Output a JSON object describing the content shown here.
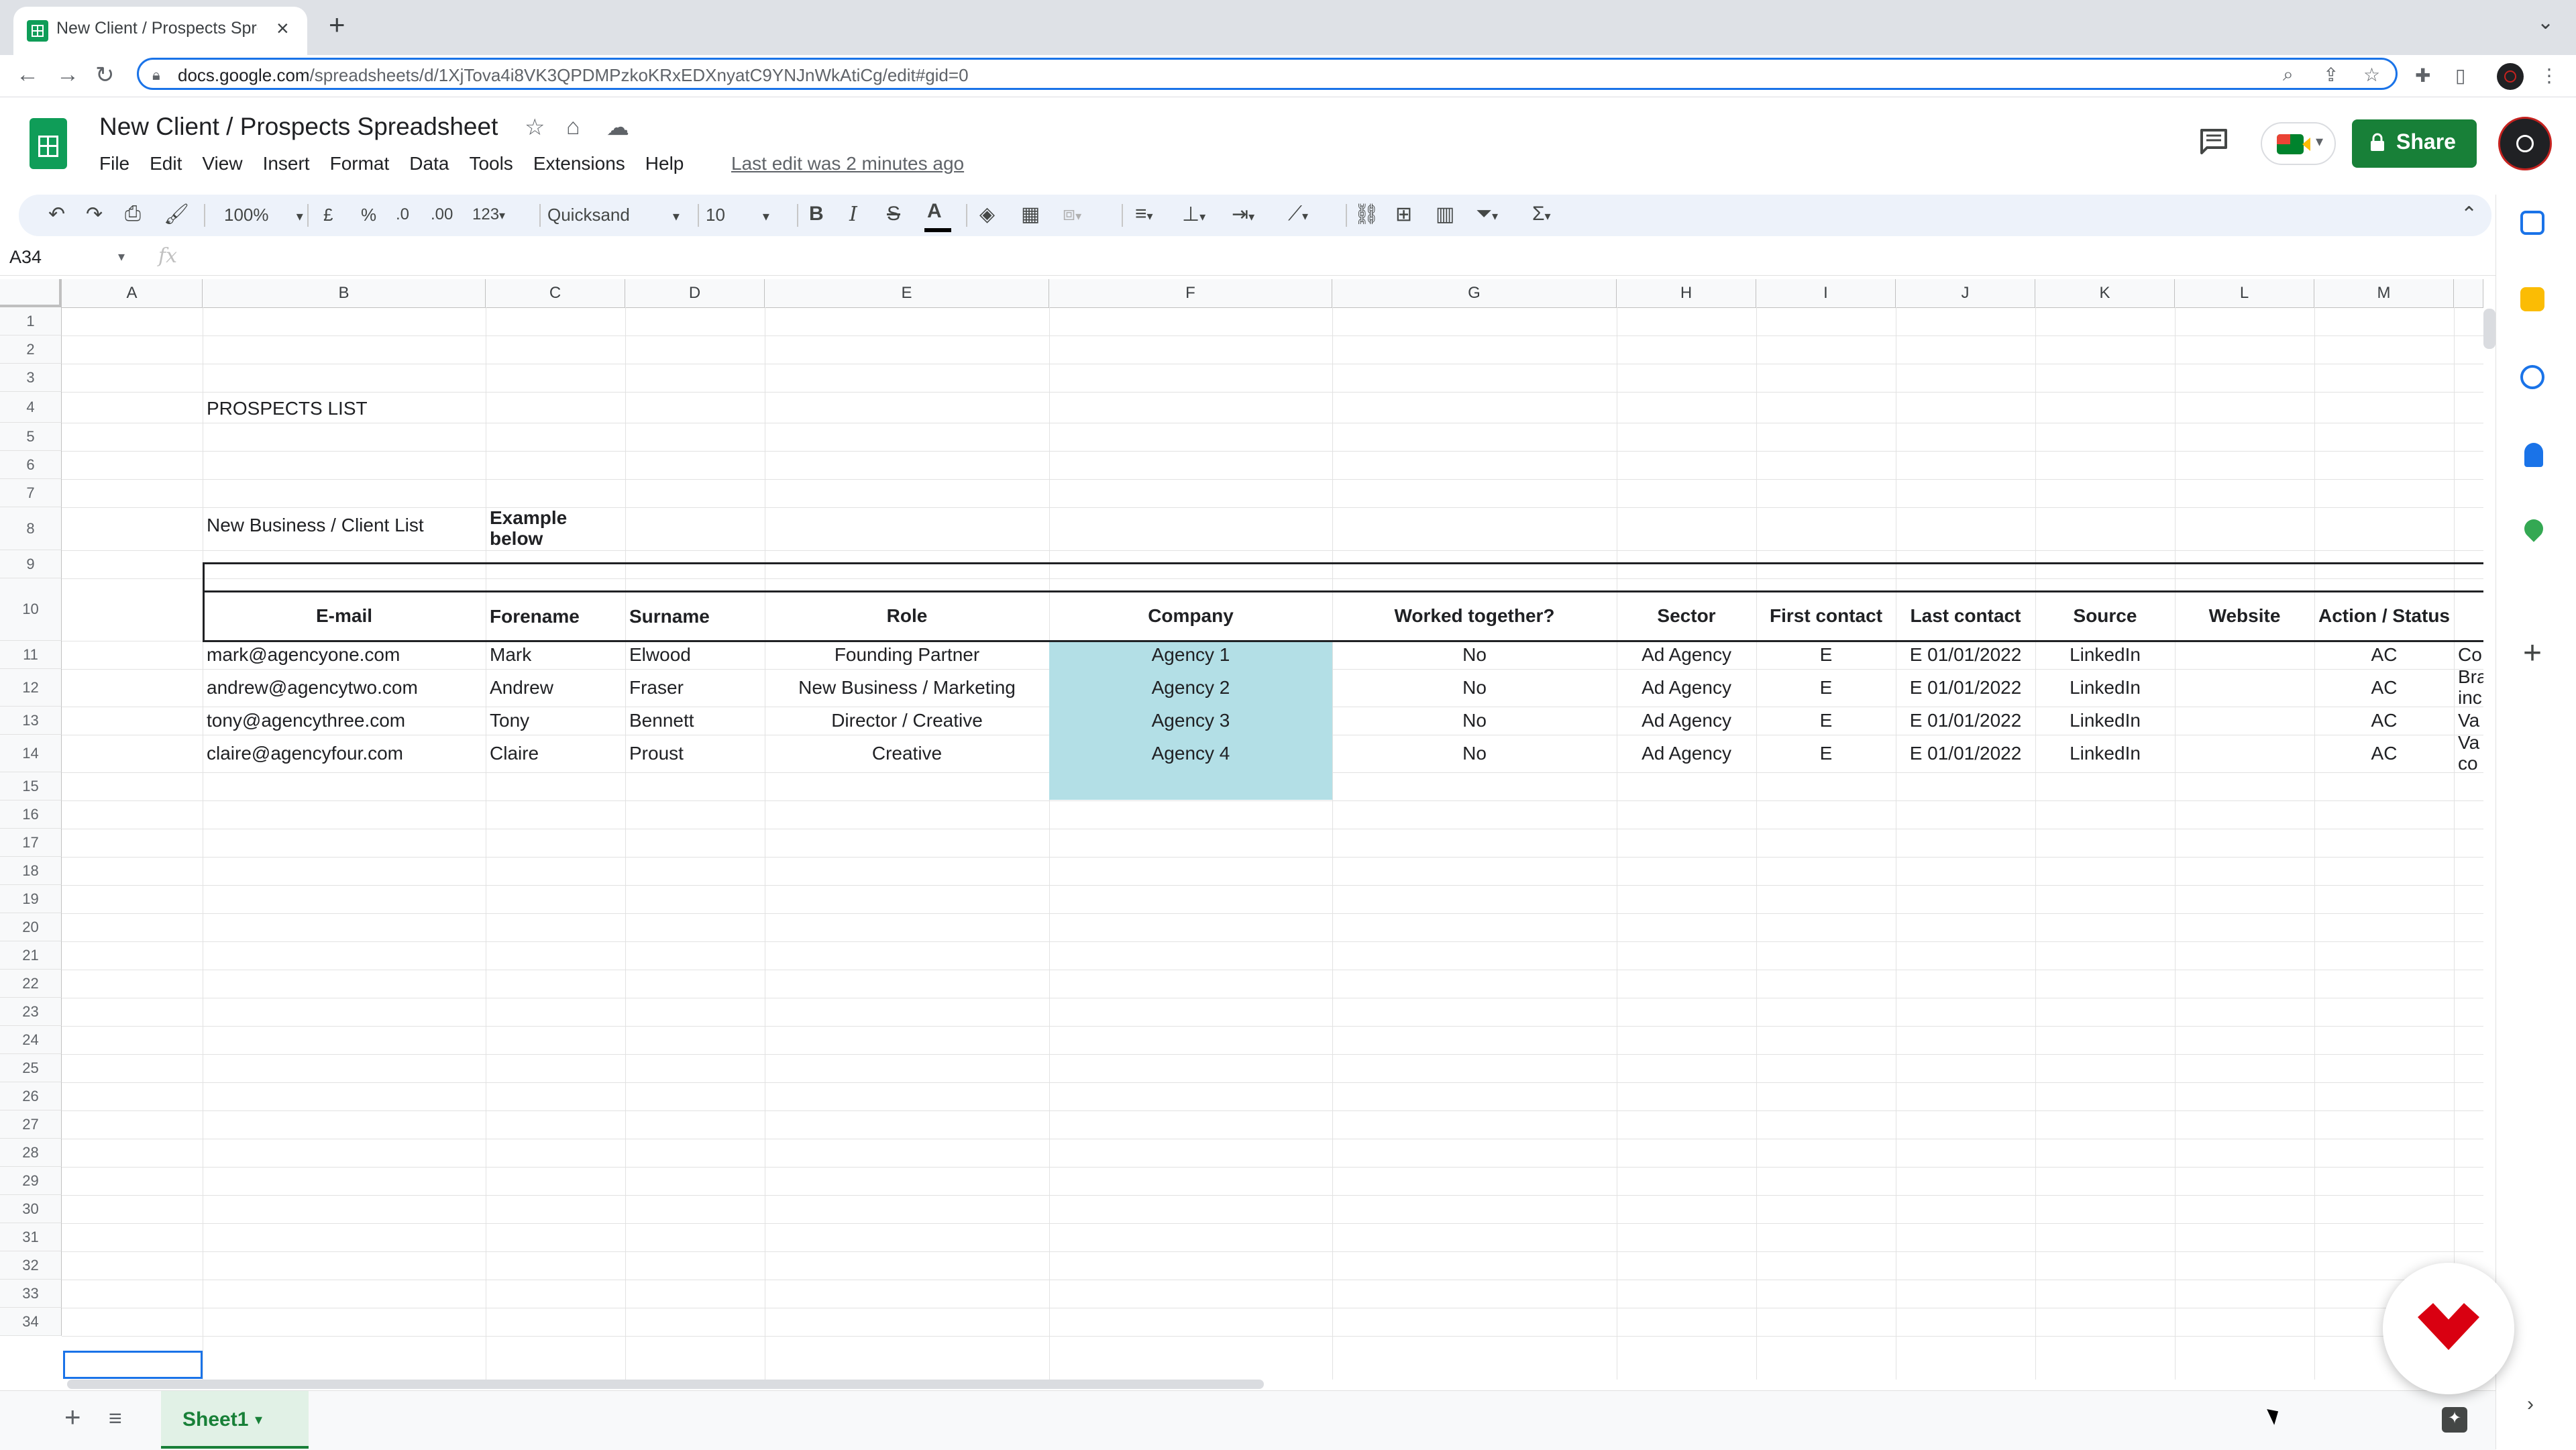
{
  "browser": {
    "tab_title": "New Client / Prospects Spreadsheet",
    "url_host": "docs.google.com",
    "url_path": "/spreadsheets/d/1XjTova4i8VK3QPDMPzkoKRxEDXnyatC9YNJnWkAtiCg/edit#gid=0"
  },
  "doc": {
    "title": "New Client / Prospects Spreadsheet",
    "last_edit": "Last edit was 2 minutes ago",
    "share_label": "Share"
  },
  "menu": [
    "File",
    "Edit",
    "View",
    "Insert",
    "Format",
    "Data",
    "Tools",
    "Extensions",
    "Help"
  ],
  "toolbar": {
    "zoom": "100%",
    "currency": "£",
    "percent": "%",
    "decrease_decimal": ".0",
    "increase_decimal": ".00",
    "more_formats": "123",
    "font": "Quicksand",
    "font_size": "10",
    "bold": "B",
    "italic": "I",
    "strike": "S",
    "text_color": "A"
  },
  "formula_bar": {
    "name_box": "A34",
    "fx": "fx"
  },
  "columns": [
    "A",
    "B",
    "C",
    "D",
    "E",
    "F",
    "G",
    "H",
    "I",
    "J",
    "K",
    "L",
    "M"
  ],
  "rows": [
    "1",
    "2",
    "3",
    "4",
    "5",
    "6",
    "7",
    "8",
    "9",
    "10",
    "11",
    "12",
    "13",
    "14",
    "15",
    "16",
    "17",
    "18",
    "19",
    "20",
    "21",
    "22",
    "23",
    "24",
    "25",
    "26",
    "27",
    "28",
    "29",
    "30",
    "31",
    "32",
    "33",
    "34"
  ],
  "sheet": {
    "list_title": "PROSPECTS LIST",
    "subtitle": "New Business / Client List",
    "example_note": "Example below",
    "headers": {
      "email": "E-mail",
      "forename": "Forename",
      "surname": "Surname",
      "role": "Role",
      "company": "Company",
      "worked": "Worked together?",
      "sector": "Sector",
      "first_contact": "First contact",
      "last_contact": "Last contact",
      "source": "Source",
      "website": "Website",
      "action": "Action / Status"
    },
    "records": [
      {
        "email": "mark@agencyone.com",
        "forename": "Mark",
        "surname": "Elwood",
        "role": "Founding Partner",
        "company": "Agency 1",
        "worked": "No",
        "sector": "Ad Agency",
        "first": "E",
        "last": "E 01/01/2022",
        "source": "LinkedIn",
        "action": "AC",
        "notes": "Co"
      },
      {
        "email": "andrew@agencytwo.com",
        "forename": "Andrew",
        "surname": "Fraser",
        "role": "New Business / Marketing",
        "company": "Agency 2",
        "worked": "No",
        "sector": "Ad Agency",
        "first": "E",
        "last": "E 01/01/2022",
        "source": "LinkedIn",
        "action": "AC",
        "notes": "Bra inc"
      },
      {
        "email": "tony@agencythree.com",
        "forename": "Tony",
        "surname": "Bennett",
        "role": "Director / Creative",
        "company": "Agency 3",
        "worked": "No",
        "sector": "Ad Agency",
        "first": "E",
        "last": "E 01/01/2022",
        "source": "LinkedIn",
        "action": "AC",
        "notes": "Va"
      },
      {
        "email": "claire@agencyfour.com",
        "forename": "Claire",
        "surname": "Proust",
        "role": "Creative",
        "company": "Agency 4",
        "worked": "No",
        "sector": "Ad Agency",
        "first": "E",
        "last": "E 01/01/2022",
        "source": "LinkedIn",
        "action": "AC",
        "notes": "Va co"
      }
    ]
  },
  "bottom": {
    "sheet_tab": "Sheet1"
  },
  "colors": {
    "accent_green": "#188038",
    "company_fill": "#b3dfe6",
    "selection_blue": "#1a73e8"
  }
}
